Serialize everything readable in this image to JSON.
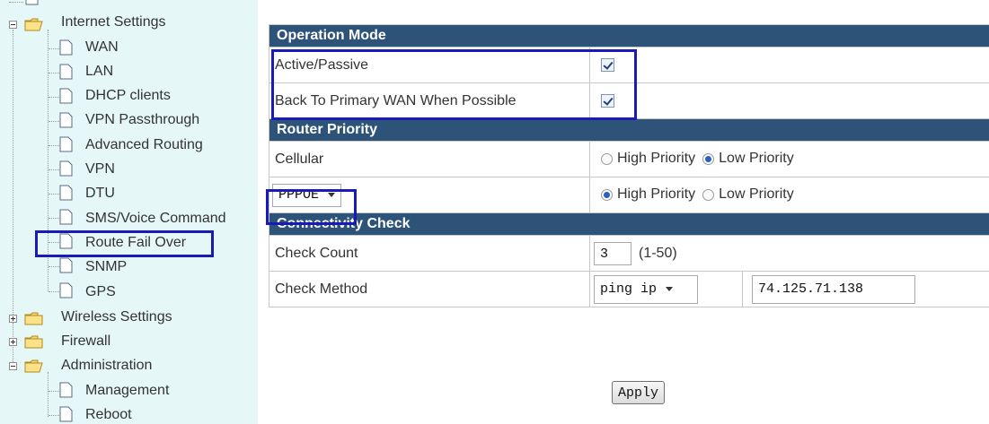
{
  "sidebar": {
    "internet_settings": "Internet Settings",
    "items": [
      {
        "label": "WAN"
      },
      {
        "label": "LAN"
      },
      {
        "label": "DHCP clients"
      },
      {
        "label": "VPN Passthrough"
      },
      {
        "label": "Advanced Routing"
      },
      {
        "label": "VPN"
      },
      {
        "label": "DTU"
      },
      {
        "label": "SMS/Voice Command"
      },
      {
        "label": "Route Fail Over"
      },
      {
        "label": "SNMP"
      },
      {
        "label": "GPS"
      }
    ],
    "wireless_settings": "Wireless Settings",
    "firewall": "Firewall",
    "administration": "Administration",
    "admin_items": [
      {
        "label": "Management"
      },
      {
        "label": "Reboot"
      }
    ]
  },
  "operation_mode": {
    "header": "Operation Mode",
    "active_passive": {
      "label": "Active/Passive",
      "checked": true
    },
    "back_to_primary": {
      "label": "Back To Primary WAN When Possible",
      "checked": true
    }
  },
  "router_priority": {
    "header": "Router Priority",
    "cellular": {
      "label": "Cellular",
      "selected": "Low Priority"
    },
    "wan_type": {
      "value": "PPPOE",
      "selected": "High Priority"
    },
    "high_label": "High Priority",
    "low_label": "Low Priority"
  },
  "connectivity": {
    "header": "Connectivity Check",
    "check_count": {
      "label": "Check Count",
      "value": "3",
      "hint": "(1-50)"
    },
    "check_method": {
      "label": "Check Method",
      "method": "ping ip",
      "ip": "74.125.71.138"
    }
  },
  "apply_label": "Apply",
  "colors": {
    "header_bg": "#2e5379",
    "sidebar_bg": "#e6f7f7",
    "highlight": "#1a1ab8"
  }
}
